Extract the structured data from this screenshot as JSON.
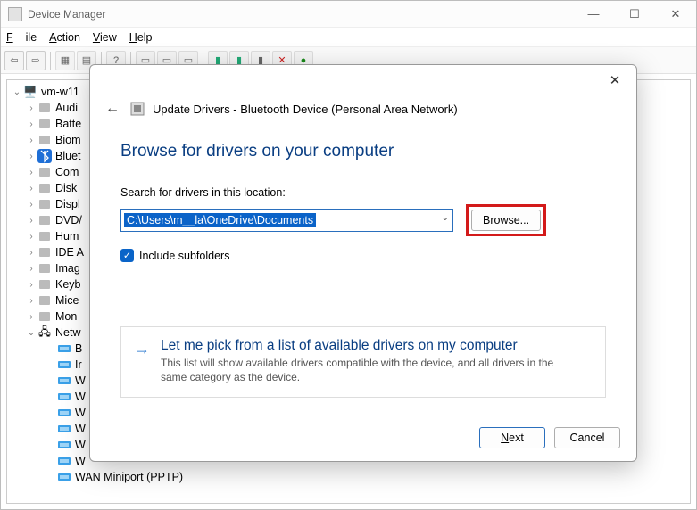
{
  "window": {
    "title": "Device Manager",
    "menu": {
      "file": "File",
      "action": "Action",
      "view": "View",
      "help": "Help"
    }
  },
  "toolbar": {
    "back": "←",
    "fwd": "→",
    "x": "✕",
    "dot": "●"
  },
  "tree": {
    "root": "vm-w11",
    "items": [
      {
        "label": "Audi"
      },
      {
        "label": "Batte"
      },
      {
        "label": "Biom"
      },
      {
        "label": "Bluet",
        "bt": true
      },
      {
        "label": "Com"
      },
      {
        "label": "Disk "
      },
      {
        "label": "Displ"
      },
      {
        "label": "DVD/"
      },
      {
        "label": "Hum"
      },
      {
        "label": "IDE A"
      },
      {
        "label": "Imag"
      },
      {
        "label": "Keyb"
      },
      {
        "label": "Mice"
      },
      {
        "label": "Mon"
      }
    ],
    "net_label": "Netw",
    "net_children": [
      "B",
      "Ir",
      "W",
      "W",
      "W",
      "W",
      "W",
      "W"
    ],
    "wan": "WAN Miniport (PPTP)"
  },
  "dialog": {
    "header": "Update Drivers - Bluetooth Device (Personal Area Network)",
    "h1": "Browse for drivers on your computer",
    "search_label": "Search for drivers in this location:",
    "path": "C:\\Users\\m__la\\OneDrive\\Documents",
    "browse": "Browse...",
    "include": "Include subfolders",
    "pick_title": "Let me pick from a list of available drivers on my computer",
    "pick_desc": "This list will show available drivers compatible with the device, and all drivers in the same category as the device.",
    "next": "Next",
    "cancel": "Cancel"
  }
}
